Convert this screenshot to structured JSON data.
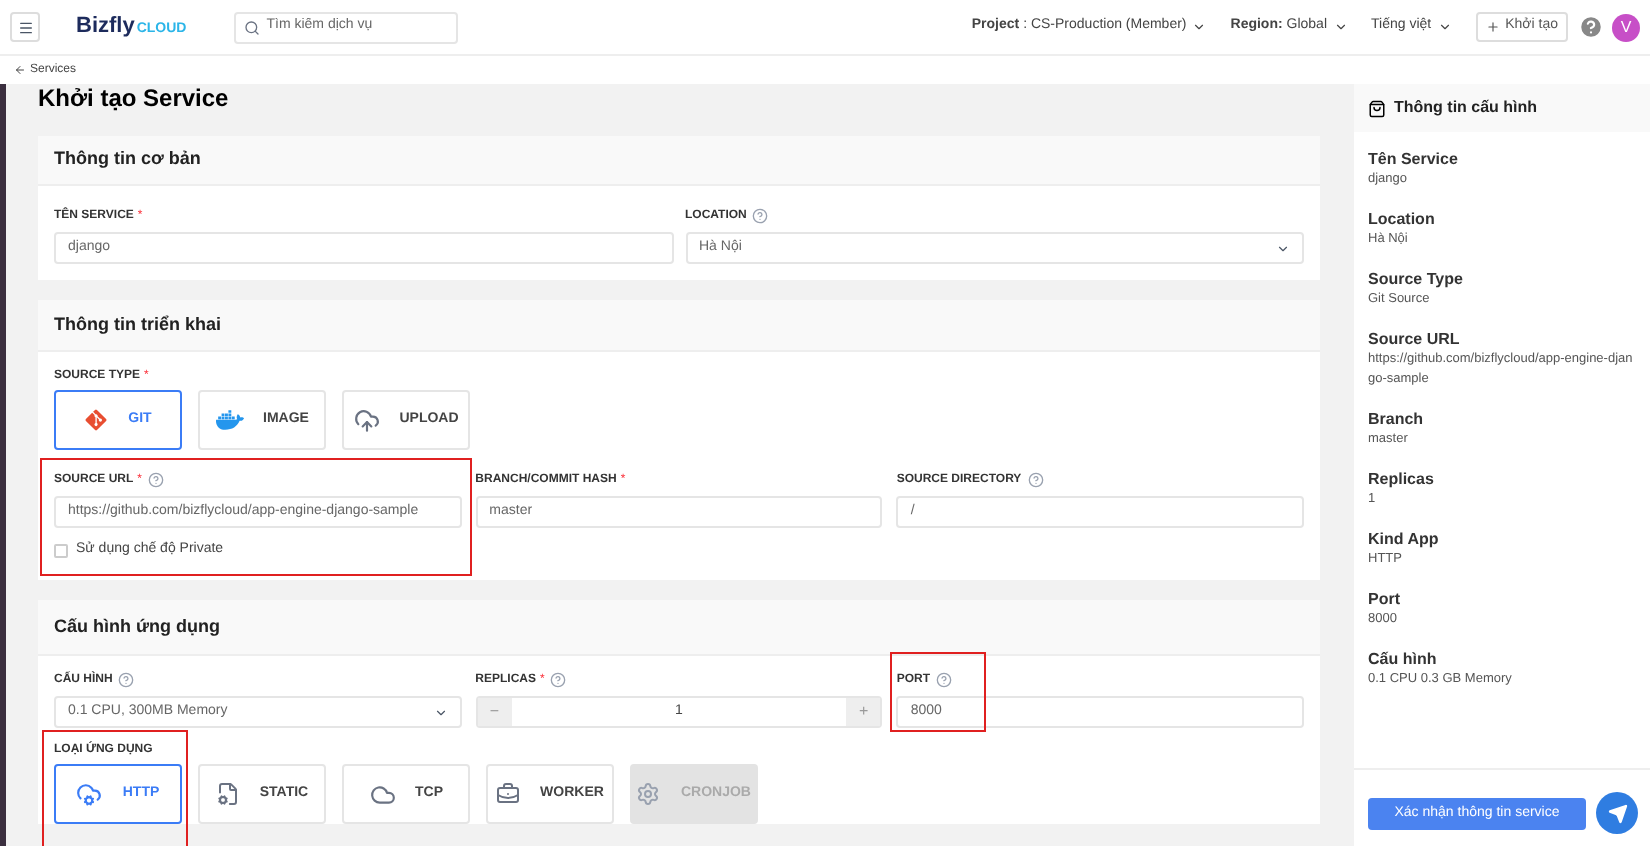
{
  "header": {
    "logo": {
      "brand": "Bizfly",
      "suffix": "CLOUD"
    },
    "search": {
      "placeholder": "Tìm kiếm dịch vụ"
    },
    "menus": [
      "**Project** : CS-Production (Member)",
      "**Region:** Global",
      "Tiếng việt"
    ],
    "create_button": "Khởi tạo",
    "avatar": "V"
  },
  "breadcrumb": "Services",
  "page_title": "Khởi tạo Service",
  "basic_info": {
    "title": "Thông tin cơ bản",
    "fields": [
      {
        "label": "TÊN SERVICE",
        "required_mark": "*",
        "help": false,
        "value": "django",
        "kind": "text"
      },
      {
        "label": "LOCATION",
        "help": true,
        "value": "Hà Nội",
        "kind": "select"
      }
    ]
  },
  "deployment": {
    "title": "Thông tin triển khai",
    "source_type": {
      "label": "SOURCE TYPE",
      "required_mark": "*",
      "options": [
        {
          "label": "GIT",
          "selected": true,
          "disabled": false
        },
        {
          "label": "IMAGE",
          "selected": false,
          "disabled": false
        },
        {
          "label": "UPLOAD",
          "selected": false,
          "disabled": false
        }
      ]
    },
    "fields": [
      {
        "label": "SOURCE URL",
        "required_mark": "*",
        "help": true,
        "value": "https://github.com/bizflycloud/app-engine-django-sample",
        "highlighted": true
      },
      {
        "label": "BRANCH/COMMIT HASH",
        "required_mark": "*",
        "help": false,
        "value": "master",
        "highlighted": false
      },
      {
        "label": "SOURCE DIRECTORY",
        "help": true,
        "value": "/",
        "highlighted": false
      }
    ],
    "private_checkbox": {
      "label": "Sử dụng chế độ Private",
      "checked": false
    }
  },
  "app_config": {
    "title": "Cấu hình ứng dụng",
    "config": {
      "label": "CẤU HÌNH",
      "help": true,
      "value": "0.1 CPU, 300MB Memory"
    },
    "replicas": {
      "label": "REPLICAS",
      "required_mark": "*",
      "help": true,
      "value": "1",
      "minus": "−",
      "plus": "+"
    },
    "port": {
      "label": "PORT",
      "help": true,
      "value": "8000",
      "highlighted": true
    },
    "app_type": {
      "label": "LOẠI ỨNG DỤNG",
      "highlighted": true,
      "options": [
        {
          "label": "HTTP",
          "selected": true,
          "disabled": false
        },
        {
          "label": "STATIC",
          "selected": false,
          "disabled": false
        },
        {
          "label": "TCP",
          "selected": false,
          "disabled": false
        },
        {
          "label": "WORKER",
          "selected": false,
          "disabled": false
        },
        {
          "label": "CRONJOB",
          "selected": false,
          "disabled": true
        }
      ]
    }
  },
  "summary": {
    "title": "Thông tin cấu hình",
    "items": [
      {
        "label": "Tên Service",
        "value": "django"
      },
      {
        "label": "Location",
        "value": "Hà Nội"
      },
      {
        "label": "Source Type",
        "value": "Git Source"
      },
      {
        "label": "Source URL",
        "value": "https://github.com/bizflycloud/app-engine-django-sample"
      },
      {
        "label": "Branch",
        "value": "master"
      },
      {
        "label": "Replicas",
        "value": "1"
      },
      {
        "label": "Kind App",
        "value": "HTTP"
      },
      {
        "label": "Port",
        "value": "8000"
      },
      {
        "label": "Cấu hình",
        "value": "0.1 CPU 0.3 GB Memory"
      }
    ],
    "confirm_button": "Xác nhận thông tin service"
  }
}
